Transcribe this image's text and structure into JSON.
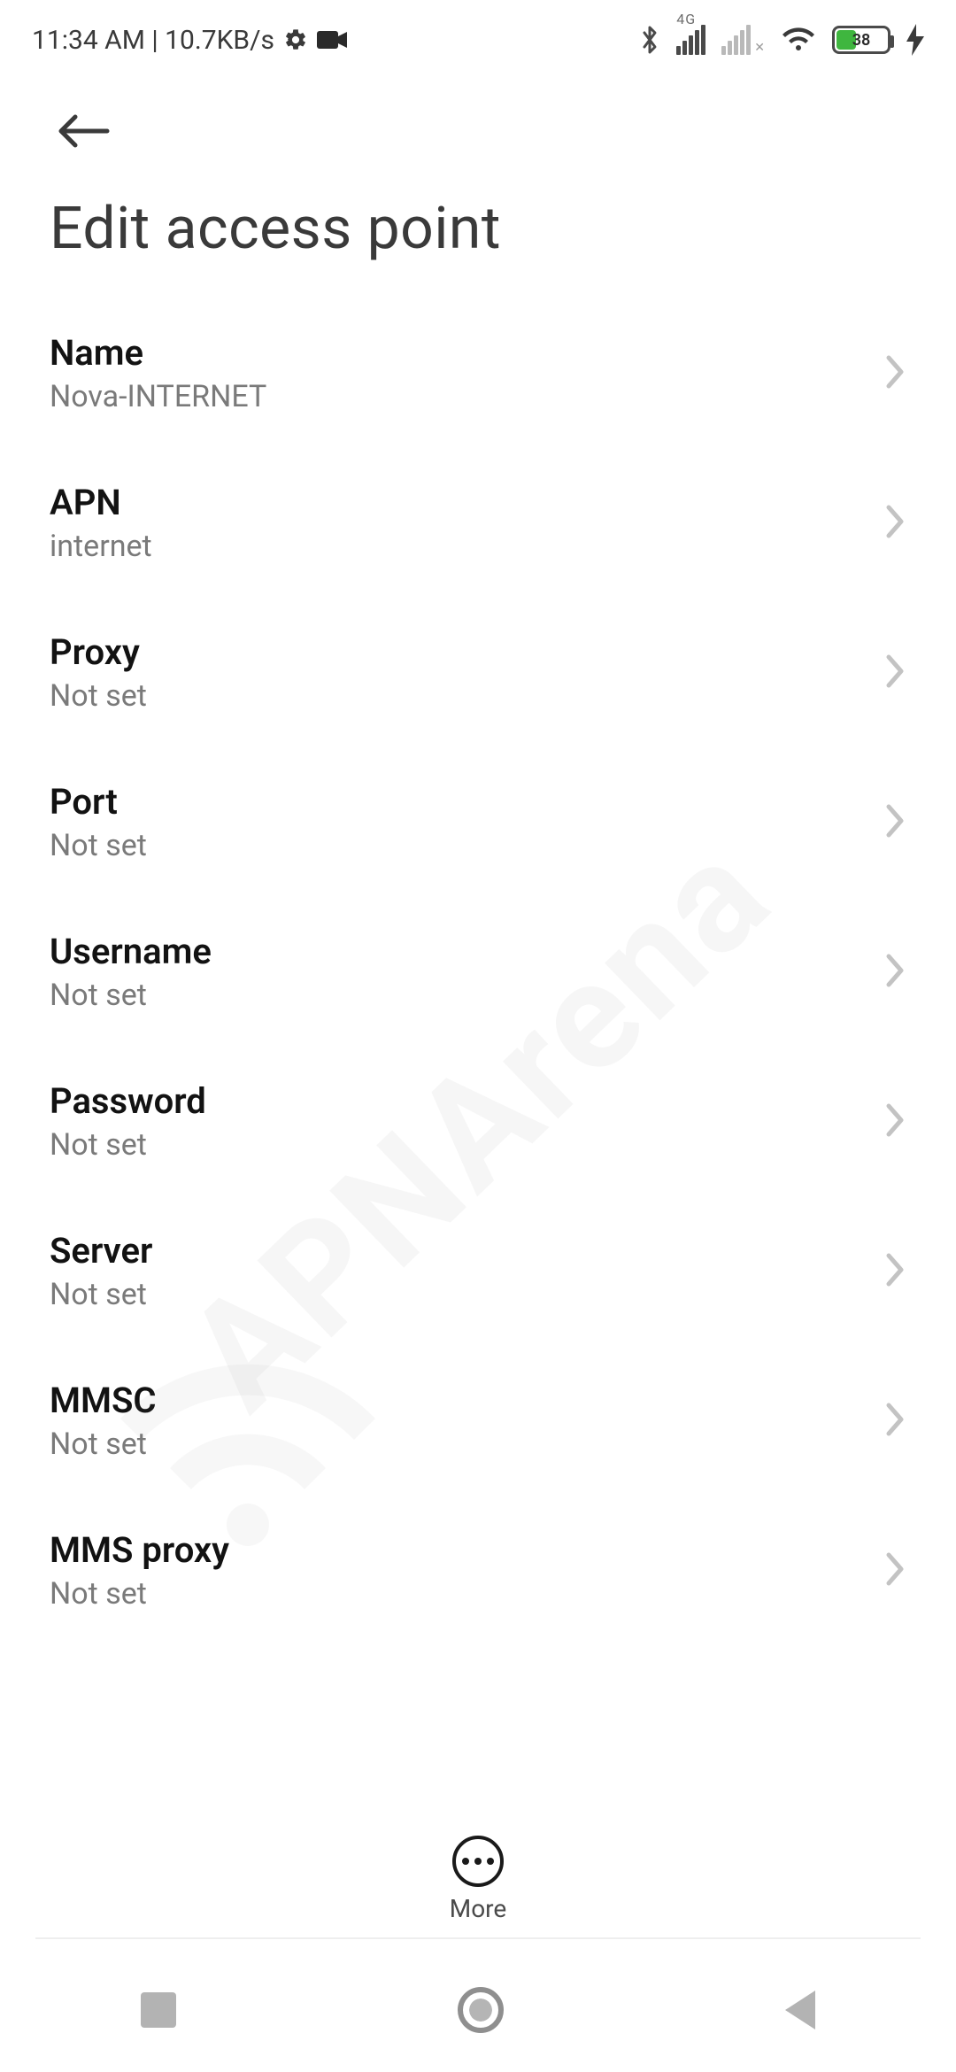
{
  "status": {
    "time_text": "11:34 AM | 10.7KB/s",
    "battery_percent": "38",
    "network_badge": "4G"
  },
  "header": {
    "title": "Edit access point"
  },
  "settings": [
    {
      "label": "Name",
      "value": "Nova-INTERNET"
    },
    {
      "label": "APN",
      "value": "internet"
    },
    {
      "label": "Proxy",
      "value": "Not set"
    },
    {
      "label": "Port",
      "value": "Not set"
    },
    {
      "label": "Username",
      "value": "Not set"
    },
    {
      "label": "Password",
      "value": "Not set"
    },
    {
      "label": "Server",
      "value": "Not set"
    },
    {
      "label": "MMSC",
      "value": "Not set"
    },
    {
      "label": "MMS proxy",
      "value": "Not set"
    }
  ],
  "bottom": {
    "more_label": "More"
  },
  "watermark": "APNArena"
}
